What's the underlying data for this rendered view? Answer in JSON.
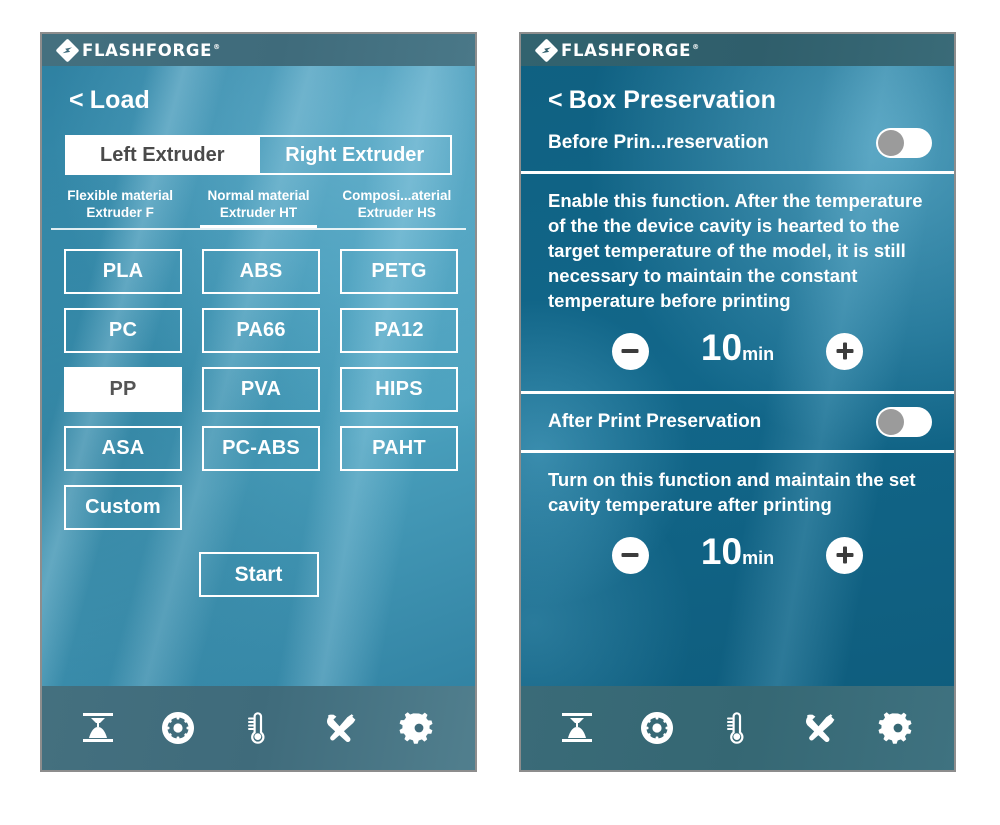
{
  "brand": {
    "name": "FLASHFORGE",
    "tm": "®"
  },
  "left_screen": {
    "title": "Load",
    "back_chevron": "<",
    "extruder_tabs": [
      {
        "label": "Left Extruder",
        "selected": true
      },
      {
        "label": "Right Extruder",
        "selected": false
      }
    ],
    "material_tabs": [
      {
        "line1": "Flexible material",
        "line2": "Extruder F",
        "selected": false
      },
      {
        "line1": "Normal material",
        "line2": "Extruder HT",
        "selected": true
      },
      {
        "line1": "Composi...aterial",
        "line2": "Extruder HS",
        "selected": false
      }
    ],
    "materials": [
      {
        "label": "PLA",
        "selected": false
      },
      {
        "label": "ABS",
        "selected": false
      },
      {
        "label": "PETG",
        "selected": false
      },
      {
        "label": "PC",
        "selected": false
      },
      {
        "label": "PA66",
        "selected": false
      },
      {
        "label": "PA12",
        "selected": false
      },
      {
        "label": "PP",
        "selected": true
      },
      {
        "label": "PVA",
        "selected": false
      },
      {
        "label": "HIPS",
        "selected": false
      },
      {
        "label": "ASA",
        "selected": false
      },
      {
        "label": "PC-ABS",
        "selected": false
      },
      {
        "label": "PAHT",
        "selected": false
      },
      {
        "label": "Custom",
        "selected": false
      }
    ],
    "start_label": "Start"
  },
  "right_screen": {
    "title": "Box Preservation",
    "back_chevron": "<",
    "section_before": {
      "toggle_label": "Before Prin...reservation",
      "toggle_on": false,
      "description": "Enable this function. After the temperature of the the device cavity is hearted to the target temperature of the model, it is still necessary to maintain the constant temperature before printing",
      "minus": "-",
      "plus": "+",
      "value": "10",
      "unit": "min"
    },
    "section_after": {
      "toggle_label": "After Print Preservation",
      "toggle_on": false,
      "description": "Turn on this function and maintain the set cavity temperature after printing",
      "minus": "-",
      "plus": "+",
      "value": "10",
      "unit": "min"
    }
  },
  "nav": {
    "items": [
      {
        "icon": "extruder-print-icon",
        "name": "print"
      },
      {
        "icon": "filament-spool-icon",
        "name": "filament"
      },
      {
        "icon": "thermometer-icon",
        "name": "temperature"
      },
      {
        "icon": "tools-icon",
        "name": "tools"
      },
      {
        "icon": "gear-icon",
        "name": "settings"
      }
    ]
  },
  "colors": {
    "left_bg": "#3e95b4",
    "right_bg": "#12678a",
    "header_left": "#3f6b7b",
    "header_right": "#2f5e6b",
    "accent_white": "#ffffff",
    "knob_gray": "#9b9b9b",
    "selected_text": "#555555"
  }
}
